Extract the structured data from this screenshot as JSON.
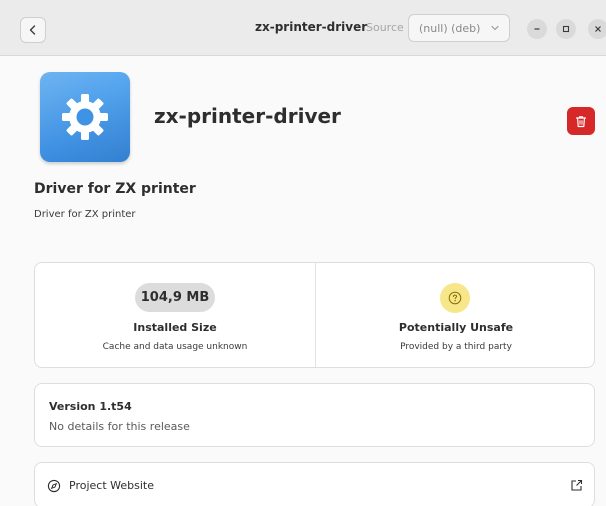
{
  "header": {
    "title": "zx-printer-driver",
    "source_label": "Source",
    "source_value": "(null) (deb)"
  },
  "app": {
    "name": "zx-printer-driver",
    "icon": "gear-icon",
    "summary": "Driver for ZX printer",
    "description": "Driver for ZX printer"
  },
  "info": {
    "size_value": "104,9 MB",
    "size_title": "Installed Size",
    "size_sub": "Cache and data usage unknown",
    "safety_title": "Potentially Unsafe",
    "safety_sub": "Provided by a third party"
  },
  "version": {
    "title": "Version 1.t54",
    "details": "No details for this release"
  },
  "links": {
    "website_label": "Project Website"
  },
  "colors": {
    "accent_icon": "#4a9ee8",
    "destructive": "#d62828",
    "warning_badge": "#f8e68a"
  }
}
